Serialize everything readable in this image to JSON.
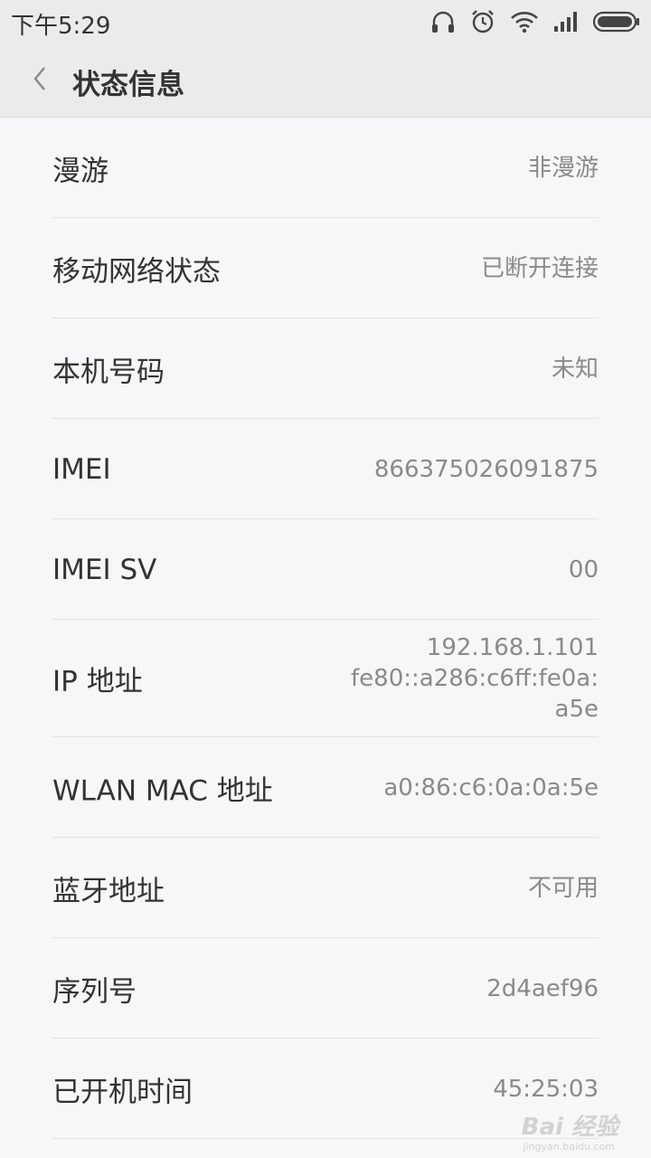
{
  "status_bar": {
    "time": "下午5:29",
    "icons": [
      "headphones-icon",
      "alarm-icon",
      "wifi-icon",
      "signal-icon",
      "battery-icon"
    ]
  },
  "header": {
    "title": "状态信息",
    "back_icon": "chevron-left-icon"
  },
  "rows": [
    {
      "label": "漫游",
      "value": "非漫游"
    },
    {
      "label": "移动网络状态",
      "value": "已断开连接"
    },
    {
      "label": "本机号码",
      "value": "未知"
    },
    {
      "label": "IMEI",
      "value": "866375026091875"
    },
    {
      "label": "IMEI SV",
      "value": "00"
    },
    {
      "label": "IP 地址",
      "value_lines": [
        "192.168.1.101",
        "fe80::a286:c6ff:fe0a:",
        "a5e"
      ]
    },
    {
      "label": "WLAN MAC 地址",
      "value": "a0:86:c6:0a:0a:5e"
    },
    {
      "label": "蓝牙地址",
      "value": "不可用"
    },
    {
      "label": "序列号",
      "value": "2d4aef96"
    },
    {
      "label": "已开机时间",
      "value": "45:25:03"
    }
  ],
  "watermark": {
    "text": "Bai 经验",
    "sub": "jingyan.baidu.com"
  },
  "colors": {
    "background": "#f7f6f8",
    "header_background": "#ebebec",
    "label_text": "#333333",
    "value_text": "#8a8a8a",
    "divider": "#e2e2e4"
  }
}
